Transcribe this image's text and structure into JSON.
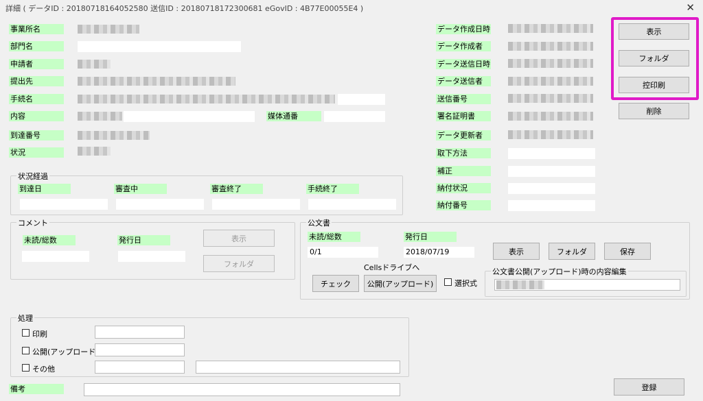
{
  "window": {
    "title": "詳細 ( データID : 20180718164052580 送信ID : 20180718172300681 eGovID : 4B77E00055E4 )",
    "close_glyph": "✕"
  },
  "left_fields": {
    "office": "事業所名",
    "department": "部門名",
    "applicant": "申請者",
    "submit_to": "提出先",
    "procedure": "手続名",
    "content": "内容",
    "medium_no": "媒体通番",
    "arrival_no": "到達番号",
    "status": "状況"
  },
  "right_fields": {
    "created_at": "データ作成日時",
    "creator": "データ作成者",
    "sent_at": "データ送信日時",
    "sender": "データ送信者",
    "send_no": "送信番号",
    "cert": "署名証明書",
    "updater": "データ更新者",
    "withdraw": "取下方法",
    "correction": "補正",
    "payment_status": "納付状況",
    "payment_no": "納付番号"
  },
  "status_progress": {
    "title": "状況経過",
    "arrival_date": "到達日",
    "reviewing": "審査中",
    "review_done": "審査終了",
    "procedure_done": "手続終了"
  },
  "comment": {
    "title": "コメント",
    "unread_total": "未読/総数",
    "issue_date": "発行日",
    "show_button": "表示",
    "folder_button": "フォルダ"
  },
  "official": {
    "title": "公文書",
    "unread_total": "未読/総数",
    "issue_date": "発行日",
    "unread_value": "0/1",
    "date_value": "2018/07/19",
    "show_button": "表示",
    "folder_button": "フォルダ",
    "save_button": "保存",
    "cells_label": "Cellsドライブへ",
    "check_button": "チェック",
    "publish_button": "公開(アップロード)",
    "select_label": "選択式",
    "edit_title": "公文書公開(アップロード)時の内容編集"
  },
  "top_buttons": {
    "show": "表示",
    "folder": "フォルダ",
    "print_copy": "控印刷",
    "delete": "削除"
  },
  "processing": {
    "title": "処理",
    "print": "印刷",
    "publish": "公開(アップロード)",
    "other": "その他"
  },
  "remarks": "備考",
  "register_button": "登録",
  "colors": {
    "label_bg": "#c6ffc6",
    "highlight": "#e01bc8"
  }
}
